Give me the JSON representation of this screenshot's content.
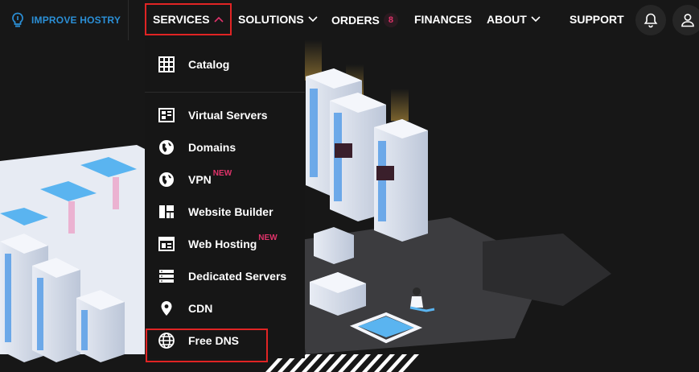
{
  "brand": {
    "label": "IMPROVE HOSTRY",
    "icon": "lightbulb-icon",
    "color": "#2b8fd6"
  },
  "nav": {
    "services": "SERVICES",
    "solutions": "SOLUTIONS",
    "orders": "ORDERS",
    "orders_count": "8",
    "finances": "FINANCES",
    "about": "ABOUT",
    "support": "SUPPORT",
    "notifications_icon": "bell-icon",
    "account_icon": "user-icon"
  },
  "services_menu": {
    "items": [
      {
        "label": "Catalog",
        "icon": "grid-icon"
      },
      {
        "label": "Virtual Servers",
        "icon": "server-card-icon"
      },
      {
        "label": "Domains",
        "icon": "globe-icon"
      },
      {
        "label": "VPN",
        "icon": "globe-icon",
        "badge": "NEW"
      },
      {
        "label": "Website Builder",
        "icon": "layout-icon"
      },
      {
        "label": "Web Hosting",
        "icon": "browser-window-icon",
        "badge": "NEW"
      },
      {
        "label": "Dedicated Servers",
        "icon": "server-stack-icon"
      },
      {
        "label": "CDN",
        "icon": "map-pin-icon"
      },
      {
        "label": "Free DNS",
        "icon": "www-globe-icon"
      }
    ]
  },
  "highlights": {
    "color": "#e02424"
  },
  "accent": {
    "new_badge": "#e0336a",
    "background": "#171717"
  }
}
